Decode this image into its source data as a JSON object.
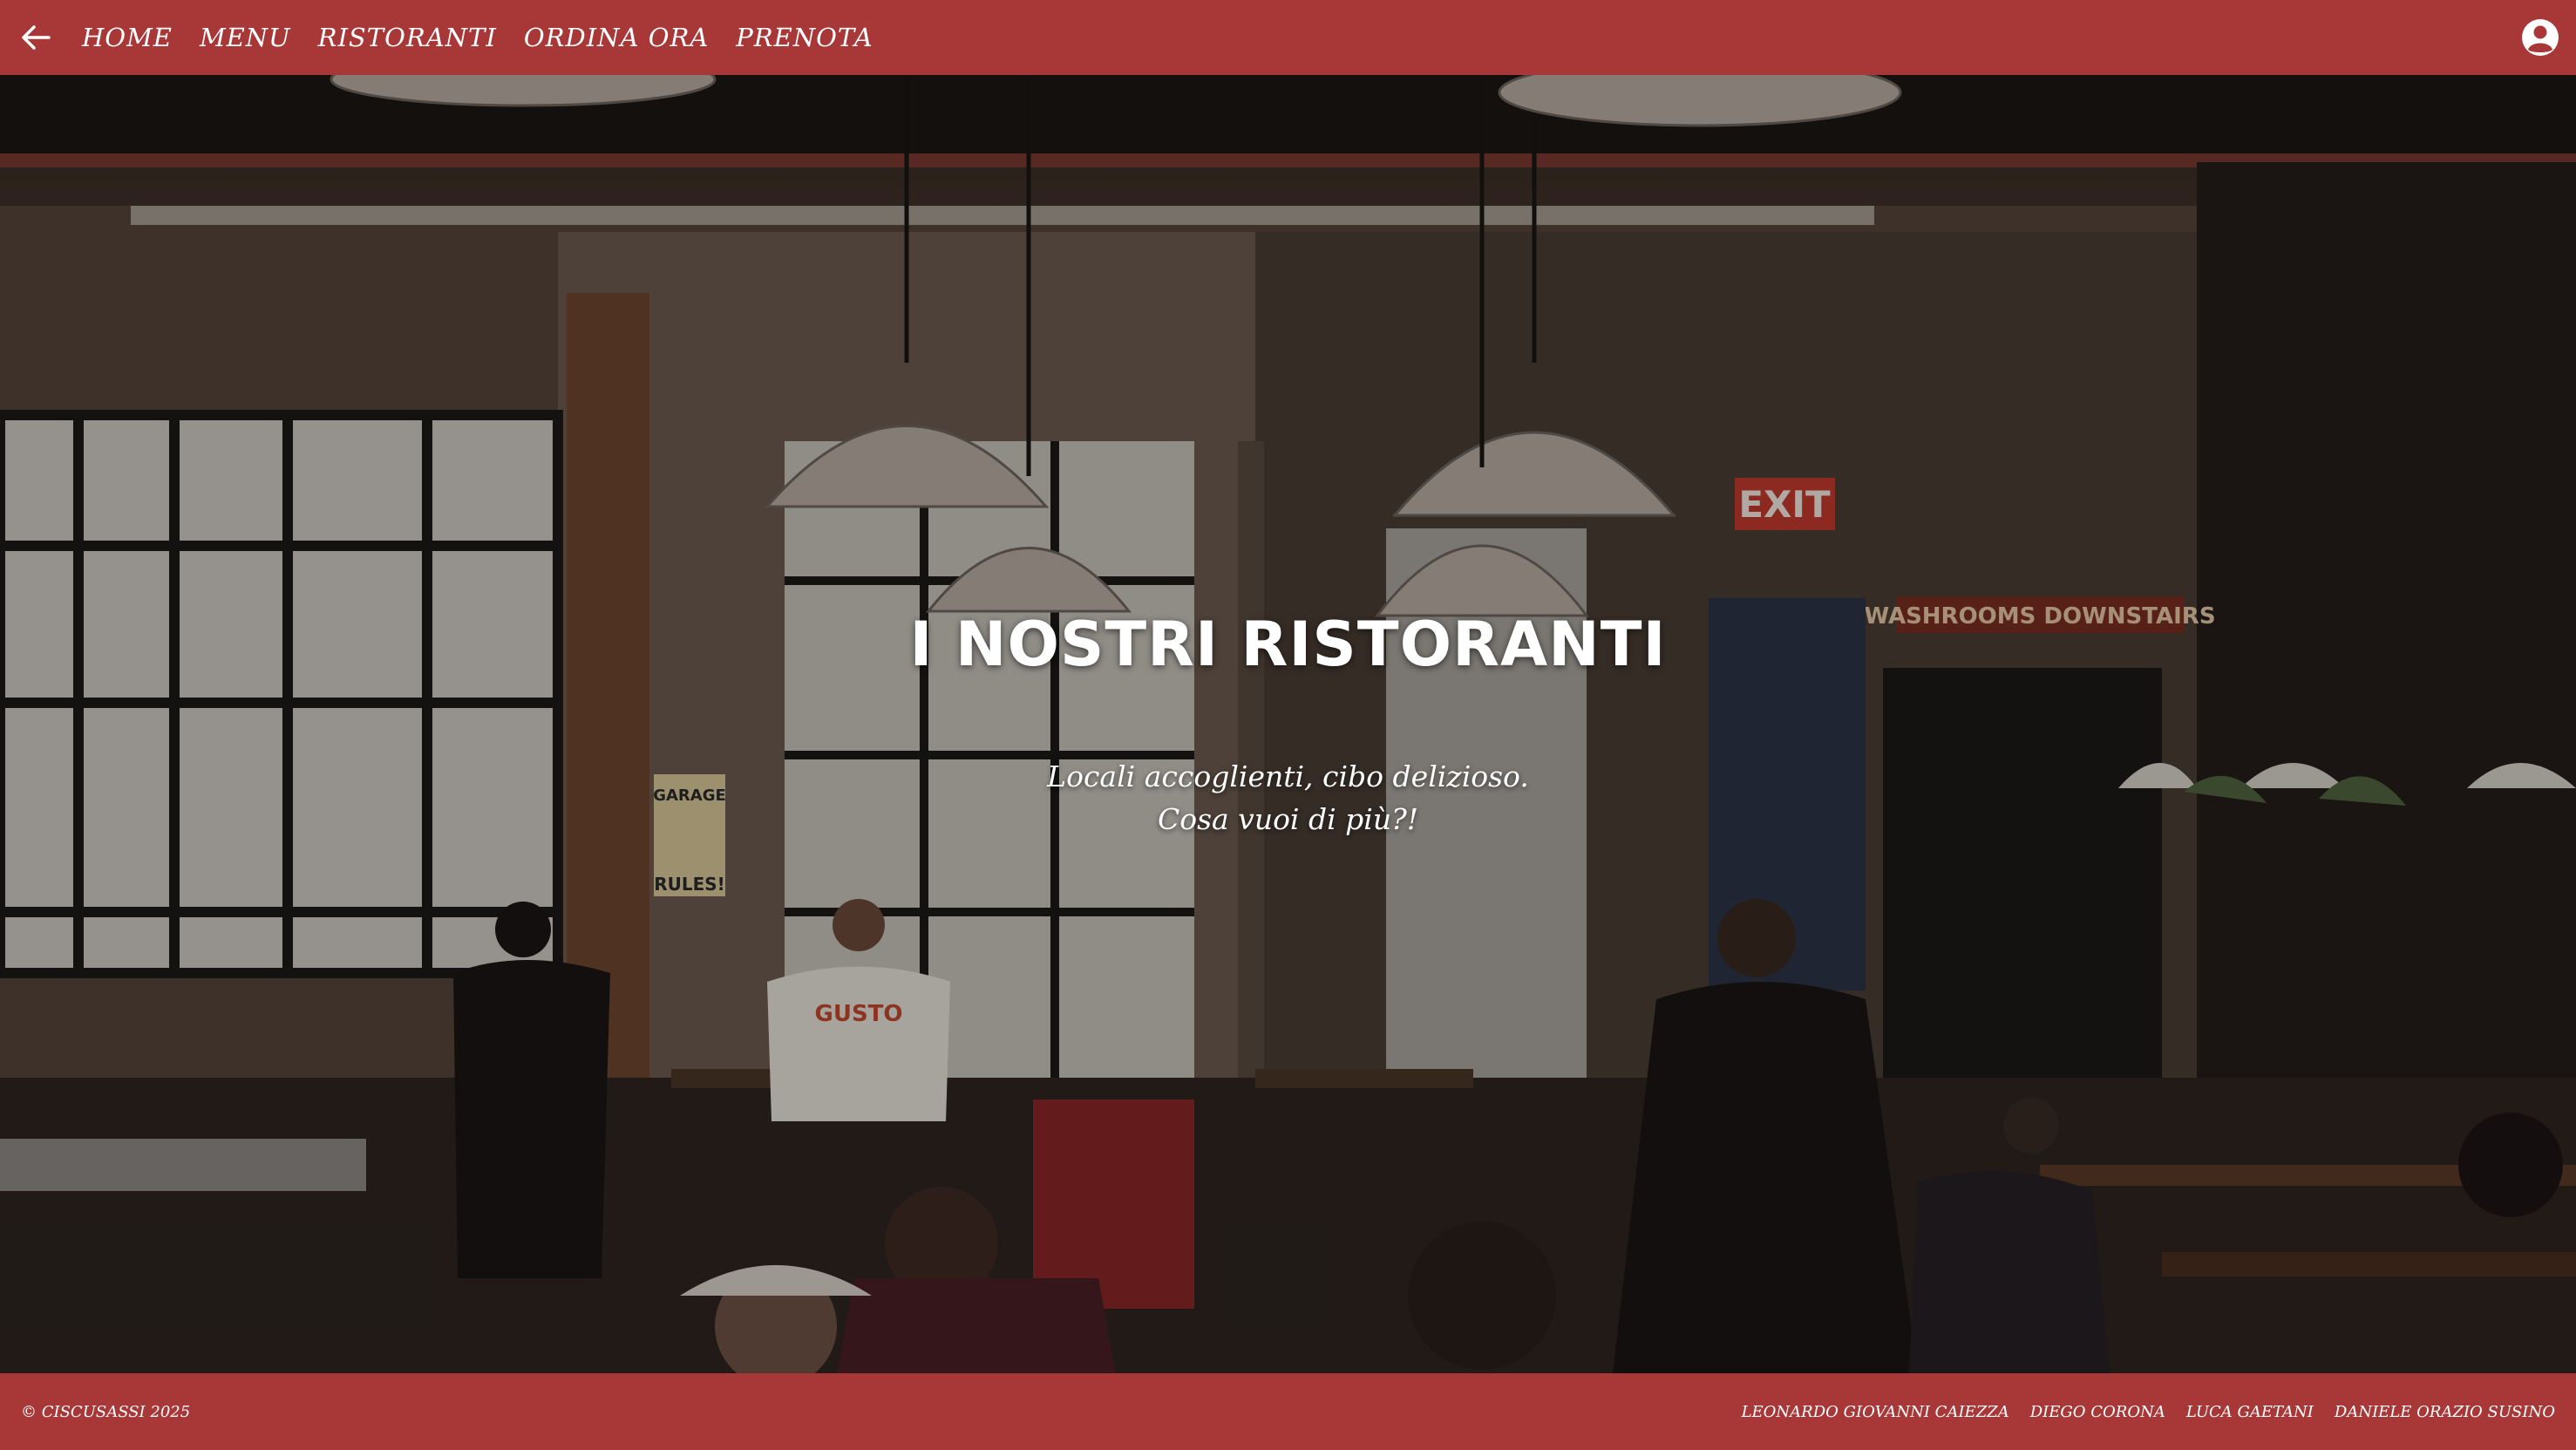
{
  "nav": {
    "links": [
      {
        "label": "HOME"
      },
      {
        "label": "MENU"
      },
      {
        "label": "RISTORANTI"
      },
      {
        "label": "ORDINA ORA"
      },
      {
        "label": "PRENOTA"
      }
    ],
    "back_icon": "arrow-left-icon",
    "account_icon": "user-circle-icon"
  },
  "hero": {
    "title": "I NOSTRI RISTORANTI",
    "subtitle_line1": "Locali accoglienti, cibo delizioso.",
    "subtitle_line2": "Cosa vuoi di più?!",
    "sign_exit": "EXIT",
    "sign_washrooms": "WASHROOMS DOWNSTAIRS",
    "sign_garage": "GARAGE",
    "sign_rules": "RULES!",
    "shirt_text": "GUSTO"
  },
  "footer": {
    "copyright": "© CISCUSASSI 2025",
    "credits": [
      "LEONARDO GIOVANNI CAIEZZA",
      "DIEGO CORONA",
      "LUCA GAETANI",
      "DANIELE ORAZIO SUSINO"
    ]
  },
  "colors": {
    "brand_red": "#a83838",
    "text": "#ffffff"
  }
}
